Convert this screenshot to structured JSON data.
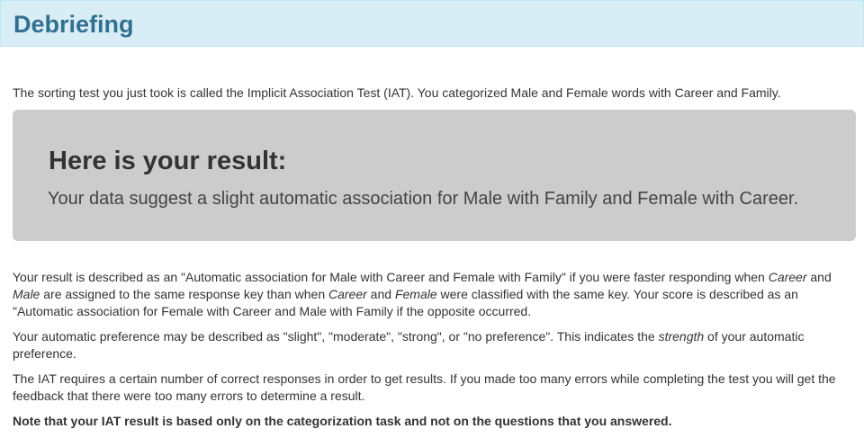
{
  "header": {
    "title": "Debriefing"
  },
  "intro": "The sorting test you just took is called the Implicit Association Test (IAT). You categorized Male and Female words with Career and Family.",
  "result": {
    "heading": "Here is your result:",
    "text": "Your data suggest a slight automatic association for Male with Family and Female with Career."
  },
  "explanation": {
    "p1_part1": "Your result is described as an \"Automatic association for Male with Career and Female with Family\" if you were faster responding when ",
    "p1_em1": "Career",
    "p1_part2": " and ",
    "p1_em2": "Male",
    "p1_part3": " are assigned to the same response key than when ",
    "p1_em3": "Career",
    "p1_part4": " and ",
    "p1_em4": "Female",
    "p1_part5": " were classified with the same key. Your score is described as an \"Automatic association for Female with Career and Male with Family if the opposite occurred.",
    "p2_part1": "Your automatic preference may be described as \"slight\", \"moderate\", \"strong\", or \"no preference\". This indicates the ",
    "p2_em": "strength",
    "p2_part2": " of your automatic preference.",
    "p3": "The IAT requires a certain number of correct responses in order to get results. If you made too many errors while completing the test you will get the feedback that there were too many errors to determine a result.",
    "note": "Note that your IAT result is based only on the categorization task and not on the questions that you answered."
  }
}
